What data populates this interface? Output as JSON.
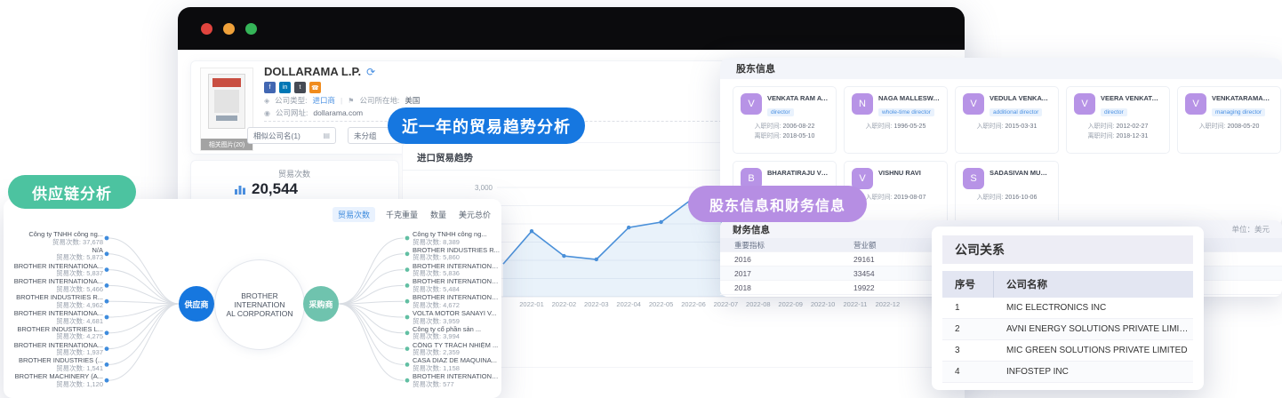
{
  "badges": {
    "supply_chain": {
      "label": "供应链分析",
      "color": "#4cc3a0"
    },
    "trade_trend": {
      "label": "近一年的贸易趋势分析",
      "color": "#1677e0"
    },
    "shareholder_finance": {
      "label": "股东信息和财务信息",
      "color": "#b68ee3"
    }
  },
  "browser": {
    "traffic_lights": [
      "#e0443e",
      "#efa13a",
      "#35b558"
    ],
    "company_card": {
      "image_caption": "相关图片(20)",
      "name": "DOLLARAMA L.P.",
      "refresh_glyph": "⟳",
      "social_icons": [
        {
          "name": "facebook-icon",
          "glyph": "f",
          "color": "#4267b2"
        },
        {
          "name": "linkedin-icon",
          "glyph": "in",
          "color": "#0077b5"
        },
        {
          "name": "twitter-icon",
          "glyph": "t",
          "color": "#454a54"
        },
        {
          "name": "phone-icon",
          "glyph": "☎",
          "color": "#f08c1e"
        }
      ],
      "type_label": "公司类型:",
      "type_value": "进口商",
      "sep": "|",
      "location_label": "公司所在地:",
      "location_value": "美国",
      "website_label": "公司网址:",
      "website_value": "dollarama.com",
      "similar_company_field": "相似公司名(1)",
      "group_select": "未分组"
    },
    "stats": {
      "label": "贸易次数",
      "value": "20,544"
    }
  },
  "chart_data": {
    "type": "area",
    "title": "进口贸易趋势",
    "x": [
      "2022-01",
      "2022-02",
      "2022-03",
      "2022-04",
      "2022-05",
      "2022-06",
      "2022-07",
      "2022-08",
      "2022-09",
      "2022-10",
      "2022-11",
      "2022-12"
    ],
    "values": [
      1800,
      1120,
      1025,
      1900,
      2050,
      2710,
      1950,
      null,
      null,
      null,
      null,
      null
    ],
    "edge_start_value": 900,
    "y_tick_labels": [
      "3,000"
    ],
    "ylim": [
      0,
      3500
    ],
    "grid": true,
    "legend": "none",
    "line_color": "#4a90d9",
    "fill_color": "rgba(74,144,217,0.12)"
  },
  "supply_panel": {
    "tabs": [
      {
        "label": "贸易次数",
        "active": true
      },
      {
        "label": "千克重量",
        "active": false
      },
      {
        "label": "数量",
        "active": false
      },
      {
        "label": "美元总价",
        "active": false
      }
    ],
    "metric_label": "贸易次数:",
    "left_role": {
      "label": "供应商",
      "color": "#1677df"
    },
    "right_role": {
      "label": "采购商",
      "color": "#6fc3ae"
    },
    "center_company": [
      "BROTHER INTERNATION",
      "AL CORPORATION"
    ],
    "suppliers": [
      {
        "name": "Công ty TNHH công ng...",
        "value": "37,678"
      },
      {
        "name": "N/A",
        "value": "5,873"
      },
      {
        "name": "BROTHER INTERNATIONA...",
        "value": "5,837"
      },
      {
        "name": "BROTHER INTERNATIONA...",
        "value": "5,466"
      },
      {
        "name": "BROTHER INDUSTRIES R...",
        "value": "4,962"
      },
      {
        "name": "BROTHER INTERNATIONA...",
        "value": "4,681"
      },
      {
        "name": "BROTHER INDUSTRIES L...",
        "value": "4,275"
      },
      {
        "name": "BROTHER INTERNATIONA...",
        "value": "1,937"
      },
      {
        "name": "BROTHER INDUSTRIES (...",
        "value": "1,541"
      },
      {
        "name": "BROTHER MACHINERY (A...",
        "value": "1,120"
      }
    ],
    "buyers": [
      {
        "name": "Công ty TNHH công ng...",
        "value": "8,389"
      },
      {
        "name": "BROTHER INDUSTRIES R...",
        "value": "5,860"
      },
      {
        "name": "BROTHER INTERNATIONA...",
        "value": "5,836"
      },
      {
        "name": "BROTHER INTERNATIONA...",
        "value": "5,484"
      },
      {
        "name": "BROTHER INTERNATIONA...",
        "value": "4,672"
      },
      {
        "name": "VOLTA MOTOR SANAYİ V...",
        "value": "3,959"
      },
      {
        "name": "Công ty cổ phần sản ...",
        "value": "3,994"
      },
      {
        "name": "CÔNG TY TRÁCH NHIỆM ...",
        "value": "2,359"
      },
      {
        "name": "CASA DIAZ DE MAQUINA...",
        "value": "1,158"
      },
      {
        "name": "BROTHER INTERNATIONA...",
        "value": "577"
      }
    ]
  },
  "shareholders": {
    "title": "股东信息",
    "avatar_color": "#b793e6",
    "join_label": "入职时间:",
    "leave_label": "离职时间:",
    "people": [
      {
        "initial": "V",
        "name": "VENKATA RAM ATLURI",
        "role": "director",
        "join": "2006-08-22",
        "leave": "2018-05-10"
      },
      {
        "initial": "N",
        "name": "NAGA MALLESWARA R...",
        "role": "whole-time director",
        "join": "1996-05-25"
      },
      {
        "initial": "V",
        "name": "VEDULA VENKATA RAM...",
        "role": "additional director",
        "join": "2015-03-31"
      },
      {
        "initial": "V",
        "name": "VEERA VENKATA SATYA...",
        "role": "director",
        "join": "2012-02-27",
        "leave": "2018-12-31"
      },
      {
        "initial": "V",
        "name": "VENKATARAMANA MAG...",
        "role": "managing director",
        "join": "2008-05-20"
      },
      {
        "initial": "B",
        "name": "BHARATIRAJU VEGIRAJU"
      },
      {
        "initial": "V",
        "name": "VISHNU RAVI",
        "join": "2019-08-07"
      },
      {
        "initial": "S",
        "name": "SADASIVAN MURALIKR...",
        "join": "2016-10-06"
      }
    ]
  },
  "finance": {
    "title": "财务信息",
    "unit": "单位：美元",
    "columns": [
      "重要指标",
      "营业额"
    ],
    "rows": [
      [
        "2016",
        "29161"
      ],
      [
        "2017",
        "33454"
      ],
      [
        "2018",
        "19922"
      ]
    ]
  },
  "relations": {
    "title": "公司关系",
    "columns": [
      "序号",
      "公司名称"
    ],
    "rows": [
      [
        "1",
        "MIC ELECTRONICS INC"
      ],
      [
        "2",
        "AVNI ENERGY SOLUTIONS PRIVATE LIMITED"
      ],
      [
        "3",
        "MIC GREEN SOLUTIONS PRIVATE LIMITED"
      ],
      [
        "4",
        "INFOSTEP INC"
      ]
    ]
  }
}
